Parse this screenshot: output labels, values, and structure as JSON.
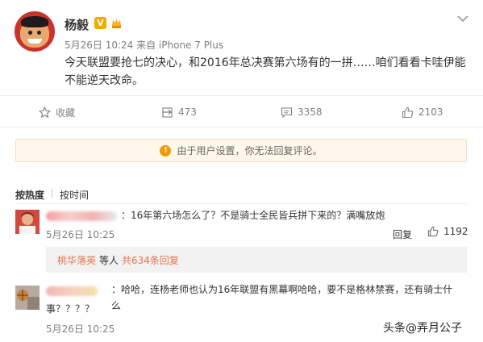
{
  "post": {
    "username": "杨毅",
    "verified_badge": "V",
    "meta": "5月26日 10:24 来自 iPhone 7 Plus",
    "text_line1": "今天联盟要抢七的决心，和2016年总决赛第六场有的一拼……咱们看看卡哇伊能",
    "text_line2": "不能逆天改命。"
  },
  "actions": {
    "favorite_label": "收藏",
    "repost_count": "473",
    "comment_count": "3358",
    "like_count": "2103"
  },
  "notice": {
    "icon": "!",
    "text": "由于用户设置，你无法回复评论。"
  },
  "sort": {
    "by_hot": "按热度",
    "by_time": "按时间"
  },
  "comments": [
    {
      "text": "：16年第六场怎么了？不是骑士全民皆兵拼下来的？满嘴放炮",
      "time": "5月26日 10:25",
      "reply_label": "回复",
      "like_count": "1192",
      "replies": {
        "user": "桃华落英",
        "middle": "等人",
        "count": "共634条回复"
      }
    },
    {
      "text_line1": "：哈哈，连杨老师也认为16年联盟有黑幕啊哈哈，要不是格林禁赛，还有骑士什么",
      "text_line2": "事？？？？",
      "time": "5月26日 10:25"
    }
  ],
  "watermark": "头条@弄月公子",
  "colors": {
    "link_orange": "#eb7350",
    "badge_gold": "#f2a900",
    "notice_bg": "#fff7eb",
    "reply_bg": "#f2f2f2"
  },
  "icons": {
    "favorite": "star-icon",
    "repost": "repost-icon",
    "comment": "comment-icon",
    "like": "thumbs-up-icon",
    "close": "chevron-down-icon",
    "notice": "exclamation-icon"
  }
}
